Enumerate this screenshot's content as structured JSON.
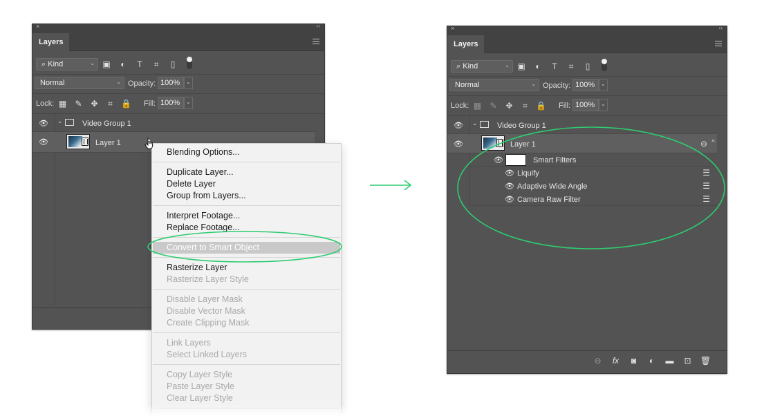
{
  "colors": {
    "panel_bg": "#535353",
    "menu_bg": "#f2f2f2",
    "annotation_green": "#2ecc71"
  },
  "left_panel": {
    "close": "×",
    "collapse": "‹‹",
    "tab": "Layers",
    "filter": {
      "kind_label": "Kind",
      "search_icon": "⌕",
      "chevron": "⌄"
    },
    "blend": {
      "mode": "Normal",
      "opacity_label": "Opacity:",
      "opacity": "100%",
      "lock_label": "Lock:",
      "fill_label": "Fill:",
      "fill": "100%"
    },
    "layers": [
      {
        "name": "Video Group 1",
        "type": "video-group"
      },
      {
        "name": "Layer 1",
        "type": "video-layer"
      }
    ]
  },
  "context_menu": {
    "items": [
      {
        "label": "Blending Options...",
        "enabled": true
      },
      {
        "label": "Duplicate Layer...",
        "enabled": true
      },
      {
        "label": "Delete Layer",
        "enabled": true
      },
      {
        "label": "Group from Layers...",
        "enabled": true
      },
      {
        "label": "Interpret Footage...",
        "enabled": true
      },
      {
        "label": "Replace Footage...",
        "enabled": true
      },
      {
        "label": "Convert to Smart Object",
        "enabled": true,
        "highlighted": true
      },
      {
        "label": "Rasterize Layer",
        "enabled": true
      },
      {
        "label": "Rasterize Layer Style",
        "enabled": false
      },
      {
        "label": "Disable Layer Mask",
        "enabled": false
      },
      {
        "label": "Disable Vector Mask",
        "enabled": false
      },
      {
        "label": "Create Clipping Mask",
        "enabled": false
      },
      {
        "label": "Link Layers",
        "enabled": false
      },
      {
        "label": "Select Linked Layers",
        "enabled": false
      },
      {
        "label": "Copy Layer Style",
        "enabled": false
      },
      {
        "label": "Paste Layer Style",
        "enabled": false
      },
      {
        "label": "Clear Layer Style",
        "enabled": false
      }
    ]
  },
  "right_panel": {
    "close": "×",
    "collapse": "‹‹",
    "tab": "Layers",
    "filter": {
      "kind_label": "Kind",
      "search_icon": "⌕",
      "chevron": "⌄"
    },
    "blend": {
      "mode": "Normal",
      "opacity_label": "Opacity:",
      "opacity": "100%",
      "lock_label": "Lock:",
      "fill_label": "Fill:",
      "fill": "100%"
    },
    "layers": [
      {
        "name": "Video Group 1",
        "type": "video-group"
      },
      {
        "name": "Layer 1",
        "type": "smart-object"
      }
    ],
    "smart_filters": {
      "label": "Smart Filters",
      "filters": [
        "Liquify",
        "Adaptive Wide Angle",
        "Camera Raw Filter"
      ]
    }
  },
  "icons": {
    "eye": "👁",
    "folder_chevron": "⌄",
    "expand_caret": "^",
    "filter_pixel": "▣",
    "filter_adjust": "◐",
    "filter_type": "T",
    "filter_shape": "⌗",
    "filter_smart": "▯",
    "lock_transparent": "▦",
    "lock_paint": "✎",
    "lock_move": "✥",
    "lock_artboard": "⌗",
    "lock_all": "🔒",
    "link": "⊖",
    "fx": "fx",
    "mask": "◙",
    "adjustment": "◐",
    "folder": "▬",
    "new_layer": "⊡",
    "trash": "🗑",
    "filter_options": "☰",
    "arrow": "⟶"
  }
}
